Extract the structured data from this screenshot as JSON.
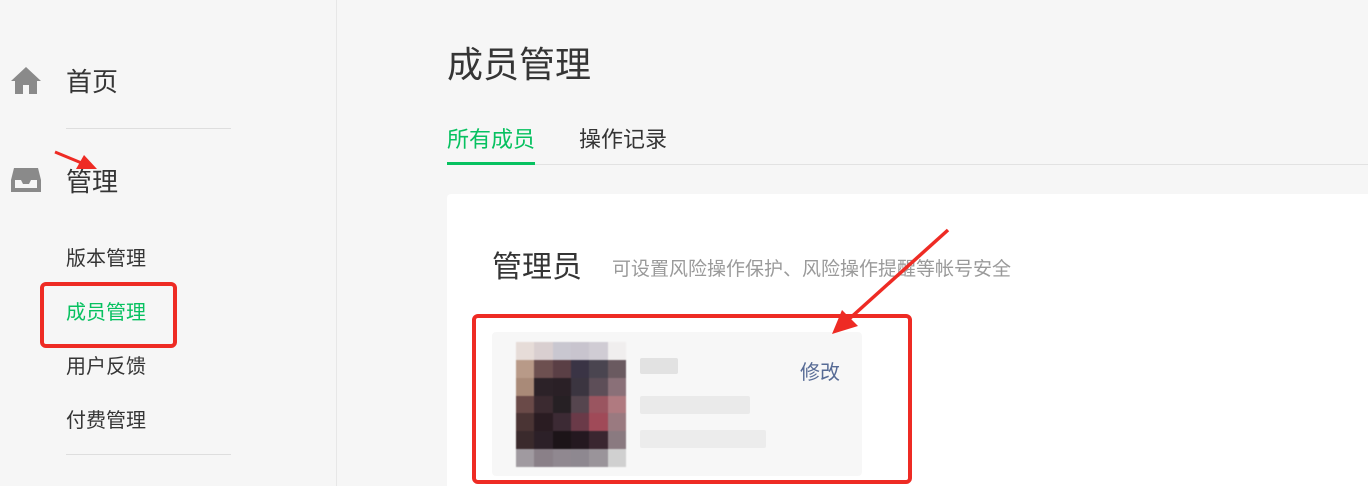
{
  "sidebar": {
    "home_label": "首页",
    "manage_label": "管理",
    "sub_items": [
      "版本管理",
      "成员管理",
      "用户反馈",
      "付费管理"
    ]
  },
  "main": {
    "page_title": "成员管理",
    "tabs": [
      "所有成员",
      "操作记录"
    ],
    "section": {
      "title": "管理员",
      "description": "可设置风险操作保护、风险操作提醒等帐号安全"
    },
    "member": {
      "edit_label": "修改"
    }
  },
  "colors": {
    "accent": "#07c160",
    "link": "#576b95",
    "annotation_red": "#ee2b24"
  }
}
